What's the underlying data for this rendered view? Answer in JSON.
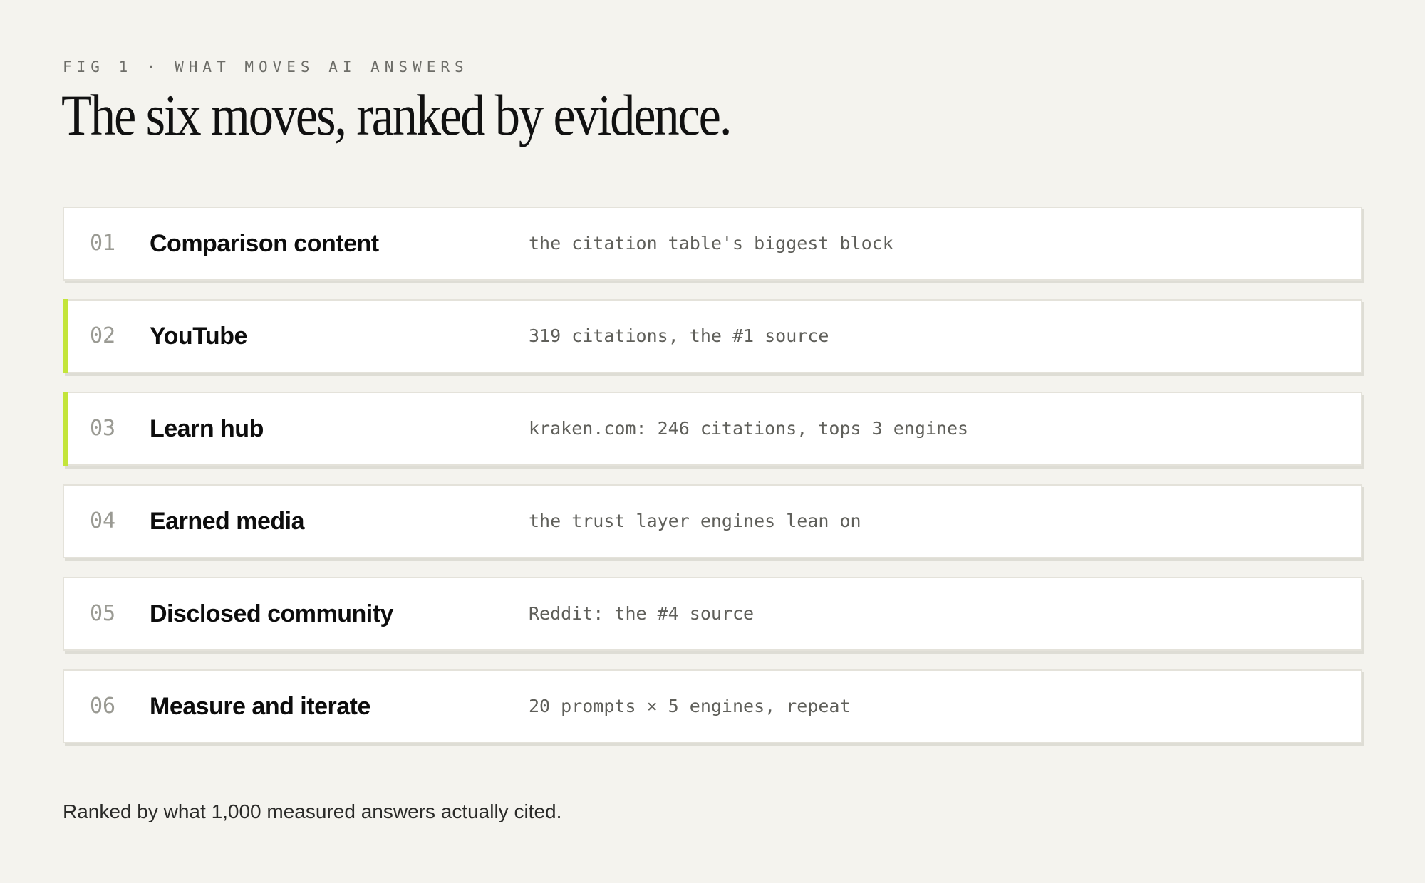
{
  "figure": {
    "eyebrow": "FIG 1 · WHAT MOVES AI ANSWERS",
    "title": "The six moves, ranked by evidence.",
    "accent_color": "#c3e53a",
    "moves": [
      {
        "number": "01",
        "name": "Comparison content",
        "note": "the citation table's biggest block",
        "highlighted": false
      },
      {
        "number": "02",
        "name": "YouTube",
        "note": "319 citations, the #1 source",
        "highlighted": true
      },
      {
        "number": "03",
        "name": "Learn hub",
        "note": "kraken.com: 246 citations, tops 3 engines",
        "highlighted": true
      },
      {
        "number": "04",
        "name": "Earned media",
        "note": "the trust layer engines lean on",
        "highlighted": false
      },
      {
        "number": "05",
        "name": "Disclosed community",
        "note": "Reddit: the #4 source",
        "highlighted": false
      },
      {
        "number": "06",
        "name": "Measure and iterate",
        "note": "20 prompts × 5 engines, repeat",
        "highlighted": false
      }
    ],
    "footnote": "Ranked by what 1,000 measured answers actually cited."
  }
}
